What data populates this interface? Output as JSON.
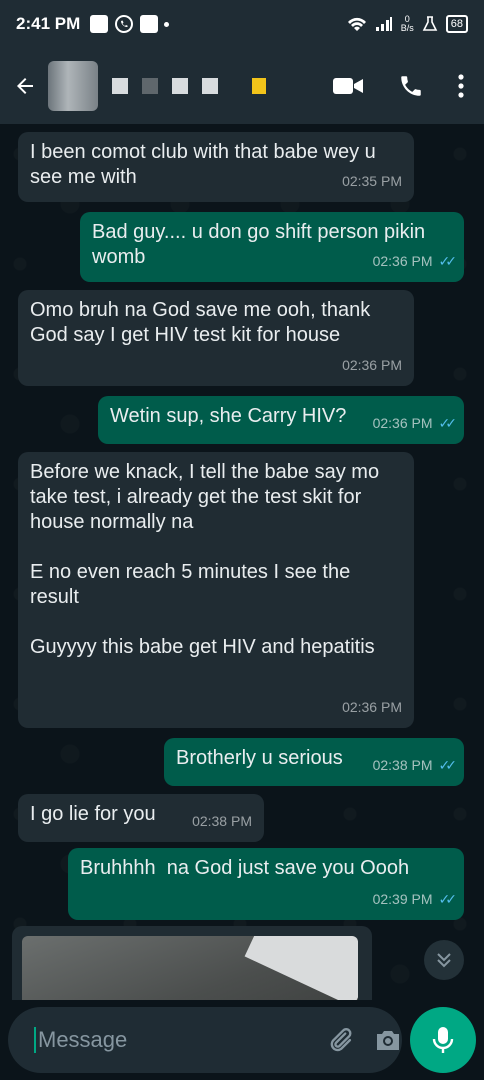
{
  "status_bar": {
    "time": "2:41 PM",
    "net_speed_value": "0",
    "net_speed_unit": "B/s",
    "battery": "68"
  },
  "header": {
    "back_icon": "arrow-back-icon",
    "actions": [
      "video-call-icon",
      "voice-call-icon",
      "more-vert-icon"
    ]
  },
  "messages": [
    {
      "dir": "in",
      "text": "I been comot club with that babe wey u see me with",
      "time": "02:35 PM"
    },
    {
      "dir": "out",
      "text": "Bad guy.... u don go shift person pikin womb",
      "time": "02:36 PM"
    },
    {
      "dir": "in",
      "text": "Omo bruh na God save me ooh, thank God say I get HIV test kit for house",
      "time": "02:36 PM"
    },
    {
      "dir": "out",
      "text": "Wetin sup, she Carry HIV?",
      "time": "02:36 PM"
    },
    {
      "dir": "in",
      "text": "Before we knack, I tell the babe say mo take test, i already get the test skit for house normally na\n\nE no even reach 5 minutes I see the result\n\nGuyyyy this babe get HIV and hepatitis",
      "time": "02:36 PM"
    },
    {
      "dir": "out",
      "text": "Brotherly u serious",
      "time": "02:38 PM"
    },
    {
      "dir": "in",
      "text": "I go lie for you",
      "time": "02:38 PM"
    },
    {
      "dir": "out",
      "text": "Bruhhhh  na God just save you Oooh",
      "time": "02:39 PM"
    }
  ],
  "composer": {
    "placeholder": "Message"
  },
  "colors": {
    "incoming": "#202c33",
    "outgoing": "#005c4b",
    "accent": "#00a884",
    "read_ticks": "#53bdeb"
  }
}
